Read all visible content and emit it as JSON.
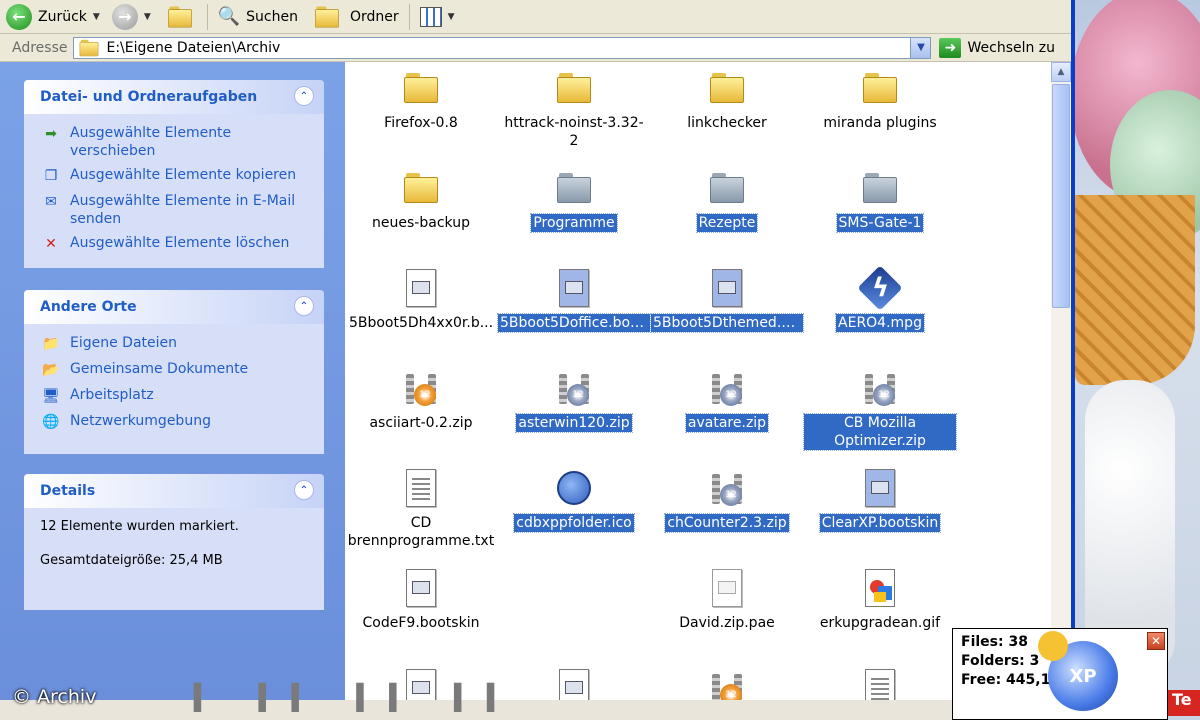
{
  "toolbar": {
    "back_label": "Zurück",
    "search_label": "Suchen",
    "folders_label": "Ordner"
  },
  "address": {
    "label": "Adresse",
    "value": "E:\\Eigene Dateien\\Archiv",
    "go_label": "Wechseln zu"
  },
  "tasks": {
    "title": "Datei- und Ordneraufgaben",
    "items": [
      {
        "label": "Ausgewählte Elemente verschieben",
        "icon": "move-icon"
      },
      {
        "label": "Ausgewählte Elemente kopieren",
        "icon": "copy-icon"
      },
      {
        "label": "Ausgewählte Elemente in E-Mail senden",
        "icon": "email-icon"
      },
      {
        "label": "Ausgewählte Elemente löschen",
        "icon": "delete-icon"
      }
    ]
  },
  "places": {
    "title": "Andere Orte",
    "items": [
      {
        "label": "Eigene Dateien",
        "icon": "my-documents-icon"
      },
      {
        "label": "Gemeinsame Dokumente",
        "icon": "shared-documents-icon"
      },
      {
        "label": "Arbeitsplatz",
        "icon": "my-computer-icon"
      },
      {
        "label": "Netzwerkumgebung",
        "icon": "network-icon"
      }
    ]
  },
  "details": {
    "title": "Details",
    "line1": "12 Elemente wurden markiert.",
    "line2": "Gesamtdateigröße: 25,4 MB"
  },
  "files": [
    {
      "name": "Firefox-0.8",
      "type": "folder",
      "selected": false
    },
    {
      "name": "httrack-noinst-3.32-2",
      "type": "folder",
      "selected": false
    },
    {
      "name": "linkchecker",
      "type": "folder",
      "selected": false
    },
    {
      "name": "miranda plugins",
      "type": "folder",
      "selected": false
    },
    {
      "name": "neues-backup",
      "type": "folder",
      "selected": false
    },
    {
      "name": "Programme",
      "type": "folder",
      "selected": true
    },
    {
      "name": "Rezepte",
      "type": "folder",
      "selected": true
    },
    {
      "name": "SMS-Gate-1",
      "type": "folder",
      "selected": true
    },
    {
      "name": "5Bboot5Dh4xx0r.b...",
      "type": "bootskin",
      "selected": false
    },
    {
      "name": "5Bboot5Doffice.boo...",
      "type": "bootskin",
      "selected": true
    },
    {
      "name": "5Bboot5Dthemed.b...",
      "type": "bootskin",
      "selected": true
    },
    {
      "name": "AERO4.mpg",
      "type": "mpg",
      "selected": true
    },
    {
      "name": "asciiart-0.2.zip",
      "type": "zip",
      "selected": false
    },
    {
      "name": "asterwin120.zip",
      "type": "zip",
      "selected": true
    },
    {
      "name": "avatare.zip",
      "type": "zip",
      "selected": true
    },
    {
      "name": "CB Mozilla Optimizer.zip",
      "type": "zip",
      "selected": true
    },
    {
      "name": "CD brennprogramme.txt",
      "type": "txt",
      "selected": false
    },
    {
      "name": "cdbxppfolder.ico",
      "type": "ico",
      "selected": true
    },
    {
      "name": "chCounter2.3.zip",
      "type": "zip",
      "selected": true
    },
    {
      "name": "ClearXP.bootskin",
      "type": "bootskin",
      "selected": true
    },
    {
      "name": "CodeF9.bootskin",
      "type": "bootskin",
      "selected": false
    },
    {
      "name": "",
      "type": "none",
      "selected": false
    },
    {
      "name": "David.zip.pae",
      "type": "plain",
      "selected": false
    },
    {
      "name": "erkupgradean.gif",
      "type": "gif",
      "selected": false
    }
  ],
  "tooltip": {
    "files": "Files: 38",
    "folders": "Folders: 3",
    "free": "Free: 445,15MB",
    "logo": "XP"
  },
  "overlay": {
    "copyright": "© Archiv"
  },
  "colors": {
    "selection": "#316ac5",
    "taskpane": "#7ba2e7",
    "panel_title": "#215dc6"
  }
}
